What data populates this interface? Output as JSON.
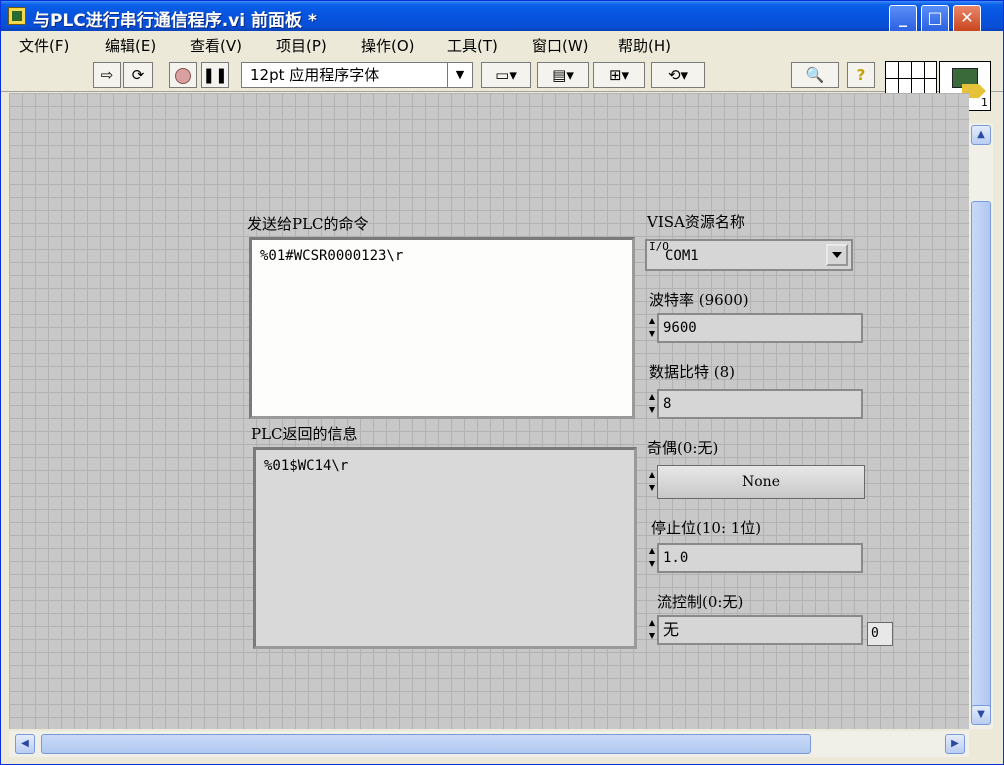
{
  "window": {
    "title": "与PLC进行串行通信程序.vi 前面板 *",
    "controls": {
      "minimize": "_",
      "maximize": "□",
      "close": "✕"
    }
  },
  "menu": {
    "items": [
      "文件(F)",
      "编辑(E)",
      "查看(V)",
      "项目(P)",
      "操作(O)",
      "工具(T)",
      "窗口(W)",
      "帮助(H)"
    ]
  },
  "toolbar": {
    "font_label": "12pt 应用程序字体",
    "icons": [
      "run-arrow-icon",
      "run-continuously-icon",
      "abort-icon",
      "pause-icon",
      "align-icon",
      "distribute-icon",
      "resize-icon",
      "reorder-icon",
      "search-icon",
      "help-icon"
    ],
    "vi_icon_number": "1"
  },
  "panel": {
    "command": {
      "label": "发送给PLC的命令",
      "value": "%01#WCSR0000123\\r"
    },
    "response": {
      "label": "PLC返回的信息",
      "value": "%01$WC14\\r"
    },
    "visa": {
      "label": "VISA资源名称",
      "prefix": "I/O",
      "value": "COM1"
    },
    "baud": {
      "label": "波特率 (9600)",
      "value": "9600"
    },
    "databits": {
      "label": "数据比特 (8)",
      "value": "8"
    },
    "parity": {
      "label": "奇偶(0:无)",
      "value": "None"
    },
    "stopbits": {
      "label": "停止位(10: 1位)",
      "value": "1.0"
    },
    "flow": {
      "label": "流控制(0:无)",
      "value": "无",
      "indicator": "0"
    }
  }
}
